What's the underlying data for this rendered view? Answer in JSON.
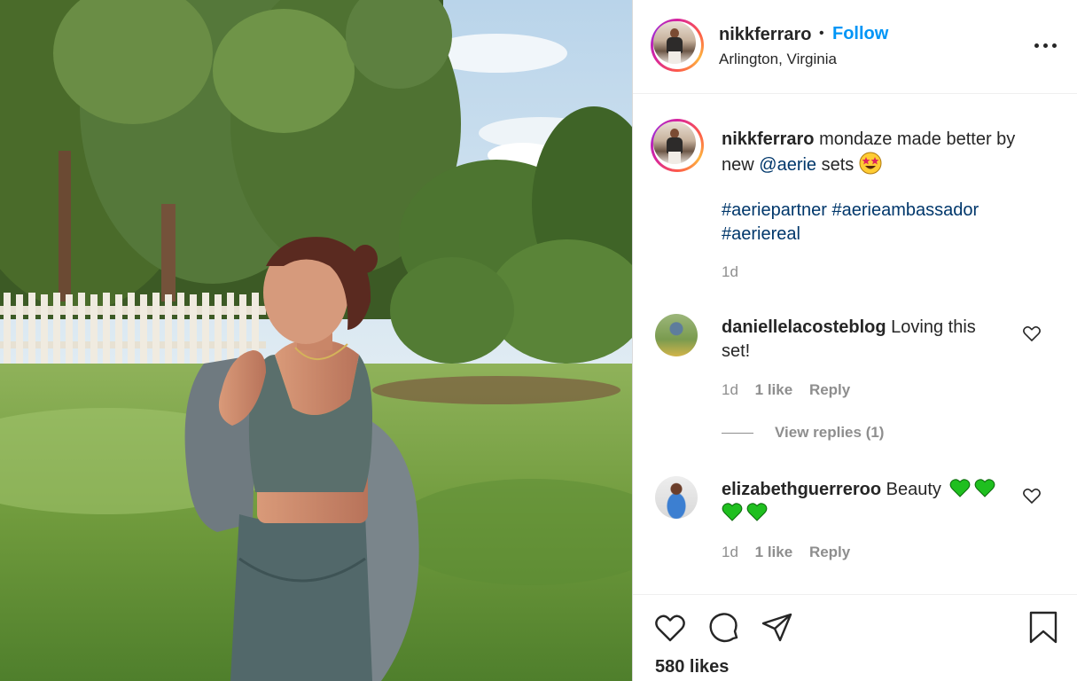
{
  "post": {
    "username": "nikkferraro",
    "follow_label": "Follow",
    "separator": "•",
    "location": "Arlington, Virginia",
    "more_icon": "more-options-icon"
  },
  "caption": {
    "username": "nikkferraro",
    "text_before_mention": "mondaze made better by new",
    "mention": "@aerie",
    "text_after_mention": "sets",
    "emoji": "star-struck-emoji",
    "hashtags": [
      "#aeriepartner",
      "#aerieambassador",
      "#aeriereal"
    ],
    "time": "1d"
  },
  "comments": [
    {
      "username": "daniellelacosteblog",
      "text": "Loving this set!",
      "time": "1d",
      "likes": "1 like",
      "reply_label": "Reply",
      "view_replies": "View replies (1)"
    },
    {
      "username": "elizabethguerreroo",
      "text": "Beauty",
      "emoji": "green-heart-emoji",
      "emoji_count": 4,
      "time": "1d",
      "likes": "1 like",
      "reply_label": "Reply"
    }
  ],
  "actions": {
    "icons": [
      "heart-icon",
      "comment-icon",
      "share-icon",
      "bookmark-icon"
    ],
    "likes_count": "580 likes"
  },
  "colors": {
    "accent": "#0095f6",
    "link": "#00376b",
    "muted": "#8e8e8e",
    "text": "#262626",
    "emoji_heart": "#1fbf1f"
  }
}
